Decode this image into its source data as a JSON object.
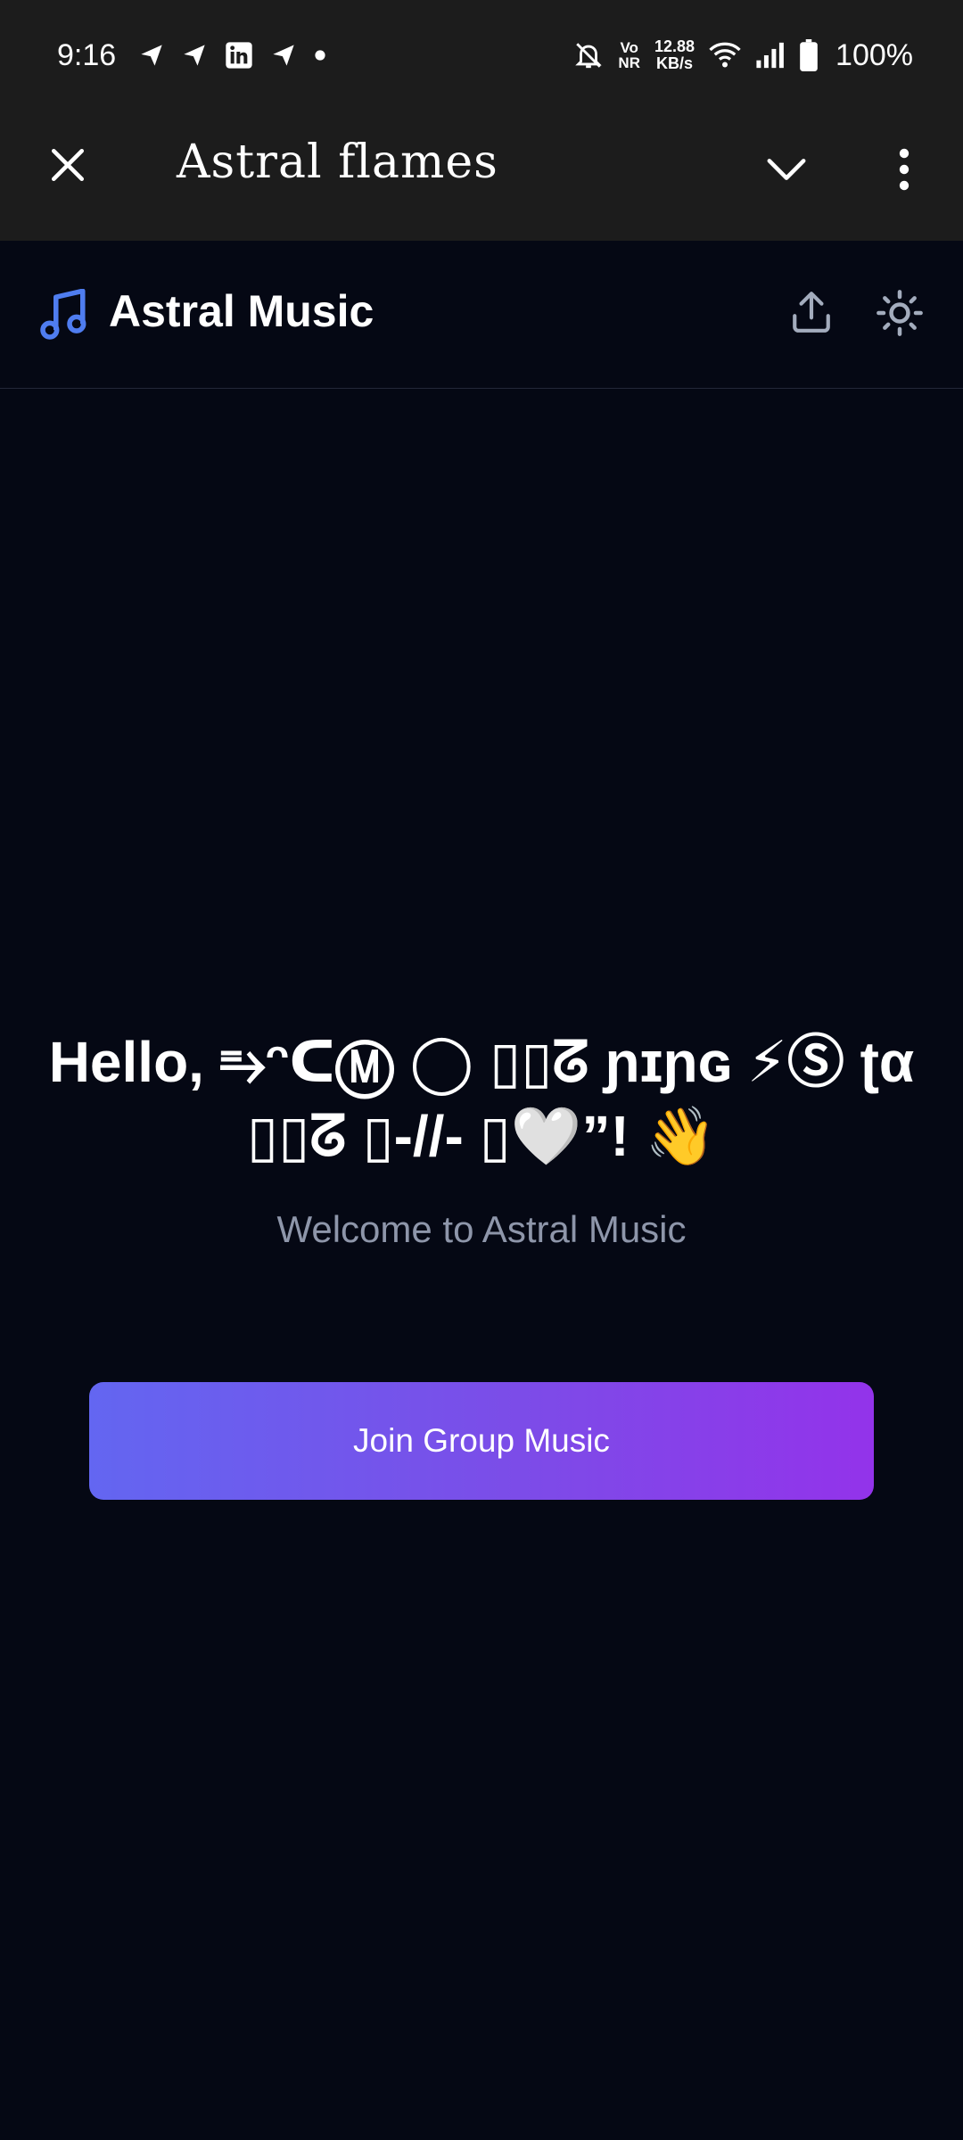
{
  "status_bar": {
    "time": "9:16",
    "volte_top": "Vo",
    "volte_bottom": "NR",
    "net_speed_value": "12.88",
    "net_speed_unit": "KB/s",
    "battery": "100%",
    "icons": [
      "telegram-icon",
      "telegram-icon",
      "linkedin-icon",
      "telegram-icon",
      "dot-icon",
      "bell-off-icon",
      "wifi-icon",
      "signal-icon",
      "battery-icon"
    ]
  },
  "top_bar": {
    "title": "Astral flames",
    "icons": [
      "close-icon",
      "chevron-down-icon",
      "more-vert-icon"
    ]
  },
  "app_header": {
    "title": "Astral Music",
    "accent_color": "#4f7df0",
    "icons": [
      "music-note-icon",
      "share-icon",
      "sun-icon"
    ]
  },
  "main": {
    "greeting": "Hello, ⥱ᵔᑕⓂ ◯ ▯▯ᘔ ɲɪɲɢ ⚡Ⓢ ʈα ▯▯ᘔ ▯-//- ▯🤍”! 👋",
    "welcome": "Welcome to Astral Music",
    "join_button": "Join Group Music",
    "button_gradient": [
      "#6366f1",
      "#9333ea"
    ]
  }
}
